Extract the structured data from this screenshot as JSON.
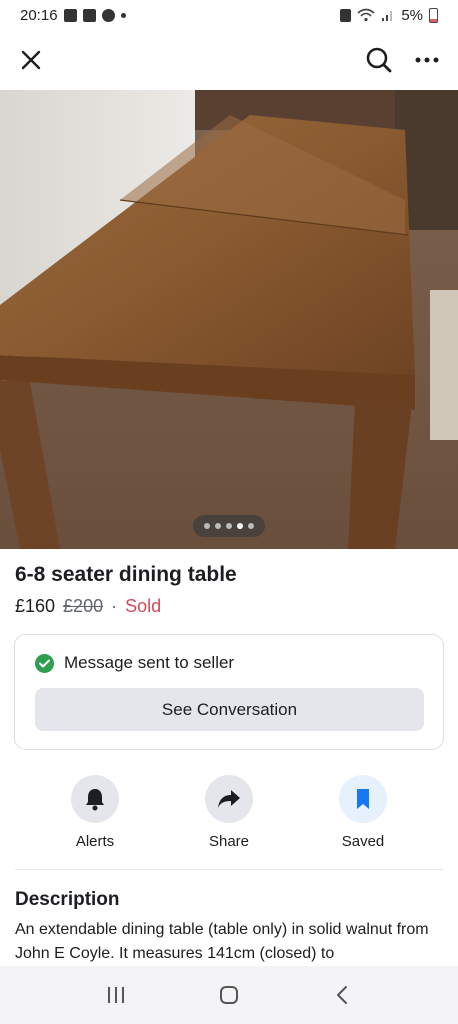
{
  "status_bar": {
    "time": "20:16",
    "battery_text": "5%"
  },
  "listing": {
    "title": "6-8 seater dining table",
    "price": "£160",
    "old_price": "£200",
    "separator": "·",
    "status": "Sold",
    "photo_count": 5,
    "active_photo": 4
  },
  "message_card": {
    "text": "Message sent to seller",
    "button_label": "See Conversation"
  },
  "actions": [
    {
      "label": "Alerts",
      "icon": "bell-icon"
    },
    {
      "label": "Share",
      "icon": "share-arrow-icon"
    },
    {
      "label": "Saved",
      "icon": "bookmark-icon"
    }
  ],
  "description": {
    "heading": "Description",
    "text": "An extendable dining table (table only) in solid walnut from John E Coyle. It measures 141cm (closed) to"
  },
  "colors": {
    "sold": "#d1495b",
    "check": "#2e9e4f",
    "saved_icon": "#1877f2"
  }
}
